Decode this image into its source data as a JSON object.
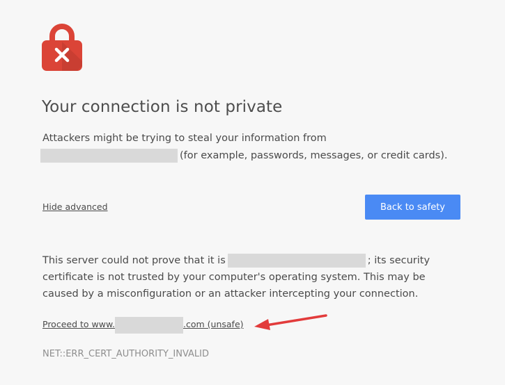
{
  "page": {
    "title": "Your connection is not private",
    "intro_line1": "Attackers might be trying to steal your information from",
    "intro_line2_suffix": "(for example, passwords, messages, or credit cards).",
    "hide_advanced_label": "Hide advanced",
    "back_button_label": "Back to safety",
    "details_line1_prefix": "This server could not prove that it is",
    "details_line1_suffix": "; its security",
    "details_line2": "certificate is not trusted by your computer's operating system. This may be",
    "details_line3": "caused by a misconfiguration or an attacker intercepting your connection.",
    "proceed_prefix": "Proceed to www.",
    "proceed_suffix": ".com (unsafe)",
    "error_code": "NET::ERR_CERT_AUTHORITY_INVALID"
  },
  "colors": {
    "background": "#f7f7f7",
    "lock_red": "#db4437",
    "button_blue": "#4a8af4",
    "arrow_red": "#e23b3b",
    "redaction_gray": "#d9d9d9"
  },
  "icons": {
    "lock": "lock-icon",
    "close": "close-icon",
    "annotation_arrow": "arrow-icon"
  }
}
